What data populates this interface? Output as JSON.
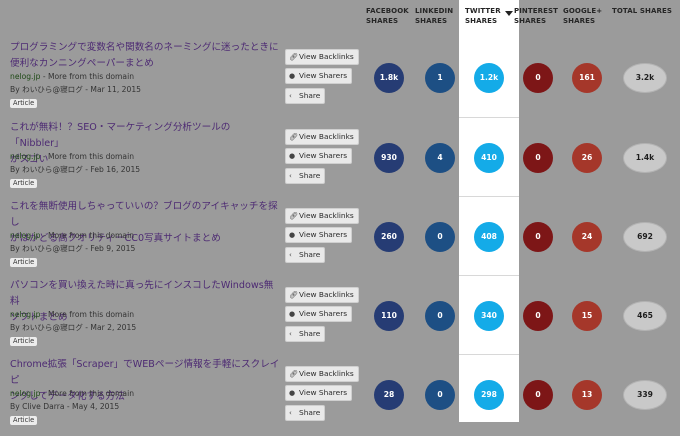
{
  "headers": {
    "facebook": [
      "FACEBOOK",
      "SHARES"
    ],
    "linkedin": [
      "LINKEDIN",
      "SHARES"
    ],
    "twitter": [
      "TWITTER",
      "SHARES"
    ],
    "pinterest": [
      "PINTEREST",
      "SHARES"
    ],
    "googleplus": [
      "GOOGLE+",
      "SHARES"
    ],
    "total": [
      "TOTAL SHARES"
    ]
  },
  "buttons": {
    "view_backlinks": "View Backlinks",
    "view_sharers": "View Sharers",
    "share": "Share"
  },
  "rows": [
    {
      "title_line1": "プログラミングで変数名や関数名のネーミングに迷ったときに",
      "title_line2": "便利なカンニングペーパーまとめ",
      "domain": "nelog.jp",
      "domain_note": " - More from this domain",
      "byline": "By わいひら@寝ログ - Mar 11, 2015",
      "tag": "Article",
      "facebook": "1.8k",
      "linkedin": "1",
      "twitter": "1.2k",
      "pinterest": "0",
      "googleplus": "161",
      "total": "3.2k"
    },
    {
      "title_line1": "これが無料！？SEO・マーケティング分析ツールの「Nibbler」",
      "title_line2": "がスゴい",
      "domain": "nelog.jp",
      "domain_note": " - More from this domain",
      "byline": "By わいひら@寝ログ - Feb 16, 2015",
      "tag": "Article",
      "facebook": "930",
      "linkedin": "4",
      "twitter": "410",
      "pinterest": "0",
      "googleplus": "26",
      "total": "1.4k"
    },
    {
      "title_line1": "これを無断使用しちゃっていいの？ブログのアイキャッチを探し",
      "title_line2": "がはかどる高クオリティーCC0写真サイトまとめ",
      "domain": "nelog.jp",
      "domain_note": " - More from this domain",
      "byline": "By わいひら@寝ログ - Feb 9, 2015",
      "tag": "Article",
      "facebook": "260",
      "linkedin": "0",
      "twitter": "408",
      "pinterest": "0",
      "googleplus": "24",
      "total": "692"
    },
    {
      "title_line1": "パソコンを買い換えた時に真っ先にインスコしたWindows無料",
      "title_line2": "ソフトまとめ",
      "domain": "nelog.jp",
      "domain_note": " - More from this domain",
      "byline": "By わいひら@寝ログ - Mar 2, 2015",
      "tag": "Article",
      "facebook": "110",
      "linkedin": "0",
      "twitter": "340",
      "pinterest": "0",
      "googleplus": "15",
      "total": "465"
    },
    {
      "title_line1": "Chrome拡張「Scraper」でWEBページ情報を手軽にスクレイピ",
      "title_line2": "ングしてデータ化する方法",
      "domain": "nelog.jp",
      "domain_note": " - More from this domain",
      "byline": "By Clive Darra - May 4, 2015",
      "tag": "Article",
      "facebook": "28",
      "linkedin": "0",
      "twitter": "298",
      "pinterest": "0",
      "googleplus": "13",
      "total": "339"
    }
  ],
  "colors": {
    "facebook": "#263c74",
    "linkedin": "#1d4f84",
    "twitter": "#14abe8",
    "pinterest": "#7d1617",
    "googleplus": "#a5372a",
    "title_link": "#4d2a73",
    "domain_link": "#1f4a16"
  },
  "icons": {
    "view_backlinks": "link-icon",
    "view_sharers": "users-icon",
    "share": "share-icon",
    "sort": "sort-desc-icon"
  }
}
